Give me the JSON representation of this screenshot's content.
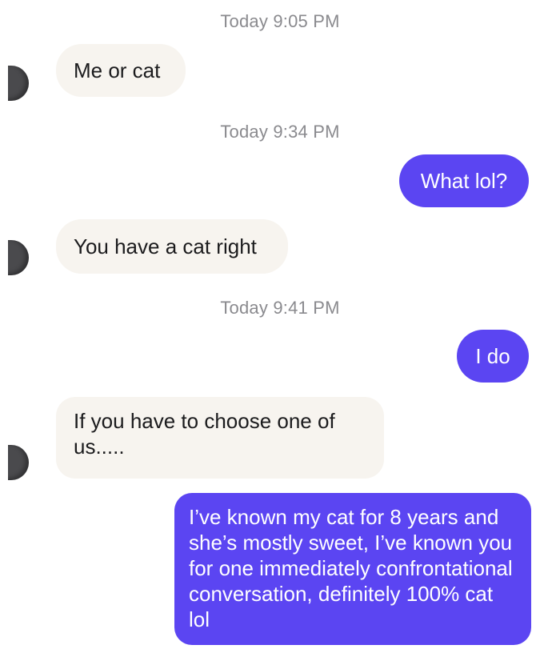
{
  "conversation": {
    "messages": [
      {
        "type": "timestamp",
        "text": "Today 9:05 PM"
      },
      {
        "type": "incoming",
        "text": "Me or cat"
      },
      {
        "type": "timestamp",
        "text": "Today 9:34 PM"
      },
      {
        "type": "outgoing",
        "text": "What lol?"
      },
      {
        "type": "incoming",
        "text": "You have a cat right"
      },
      {
        "type": "timestamp",
        "text": "Today 9:41 PM"
      },
      {
        "type": "outgoing",
        "text": "I do"
      },
      {
        "type": "incoming",
        "text": "If you have to choose one of us....."
      },
      {
        "type": "outgoing",
        "text": "I’ve known my cat for 8 years and she’s mostly sweet, I’ve known you for one immediately confrontational conversation, definitely 100% cat lol"
      }
    ]
  },
  "colors": {
    "incoming_bubble": "#f7f4ef",
    "outgoing_bubble": "#5b45f2",
    "timestamp_text": "#8a8a8e"
  },
  "icons": {
    "contact_avatar": "avatar-icon"
  }
}
